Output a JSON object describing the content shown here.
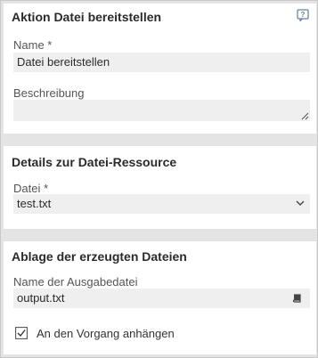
{
  "section_action": {
    "title": "Aktion Datei bereitstellen",
    "help_icon": "help-icon",
    "name_label": "Name *",
    "name_value": "Datei bereitstellen",
    "description_label": "Beschreibung",
    "description_value": ""
  },
  "section_resource": {
    "title": "Details zur Datei-Ressource",
    "file_label": "Datei *",
    "file_value": "test.txt",
    "dropdown_icon": "chevron-down-icon"
  },
  "section_output": {
    "title": "Ablage der erzeugten Dateien",
    "output_name_label": "Name der Ausgabedatei",
    "output_name_value": "output.txt",
    "picker_icon": "book-icon",
    "attach_label": "An den Vorgang anhängen",
    "attach_checked": true
  }
}
